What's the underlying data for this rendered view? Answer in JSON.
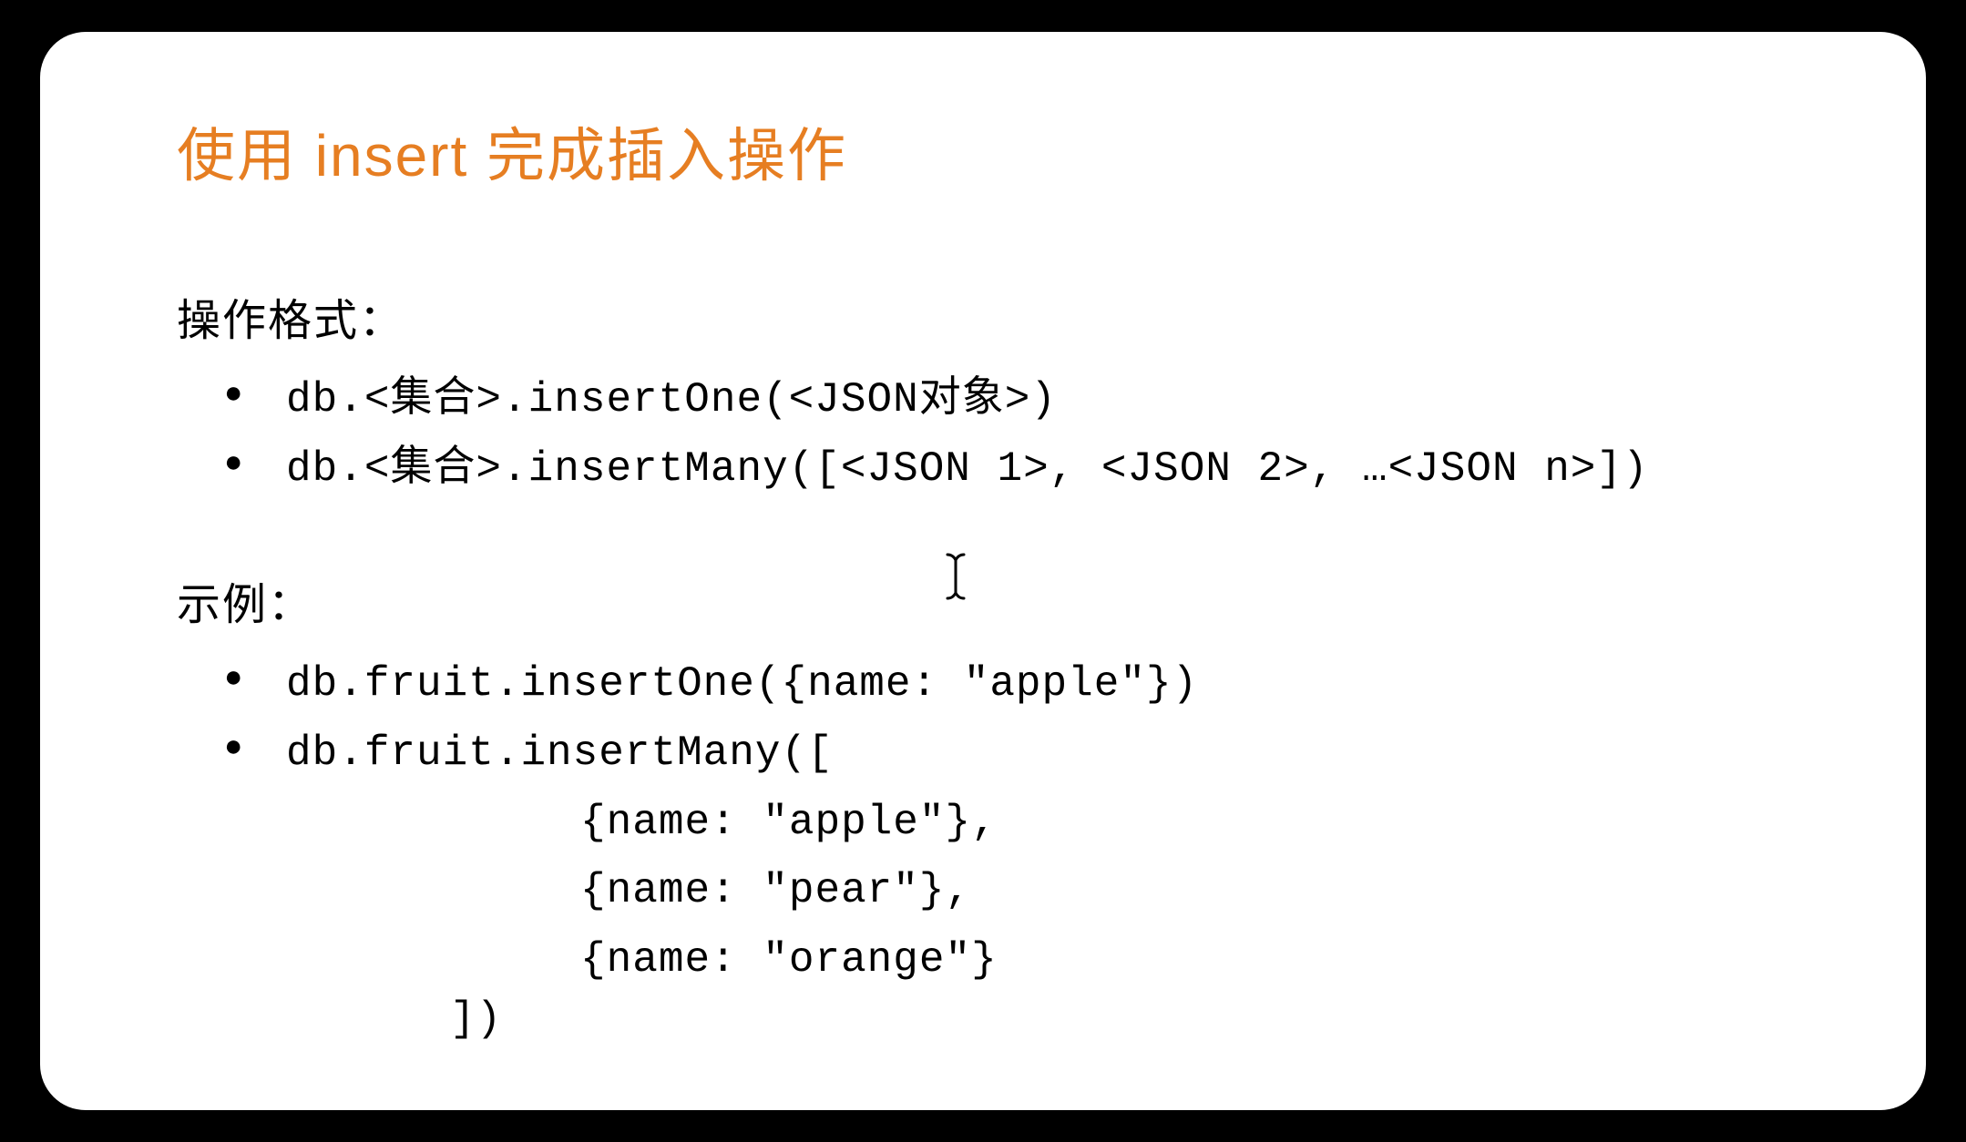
{
  "title": "使用 insert 完成插入操作",
  "sections": {
    "format": {
      "label": "操作格式：",
      "items": [
        "db.<集合>.insertOne(<JSON对象>)",
        "db.<集合>.insertMany([<JSON 1>, <JSON 2>, …<JSON n>])"
      ]
    },
    "example": {
      "label": "示例：",
      "items": [
        "db.fruit.insertOne({name: \"apple\"})",
        "db.fruit.insertMany(["
      ],
      "code_lines": [
        "     {name: \"apple\"},",
        "     {name: \"pear\"},",
        "     {name: \"orange\"}"
      ],
      "closing": "])"
    }
  },
  "cursor_glyph": "I"
}
